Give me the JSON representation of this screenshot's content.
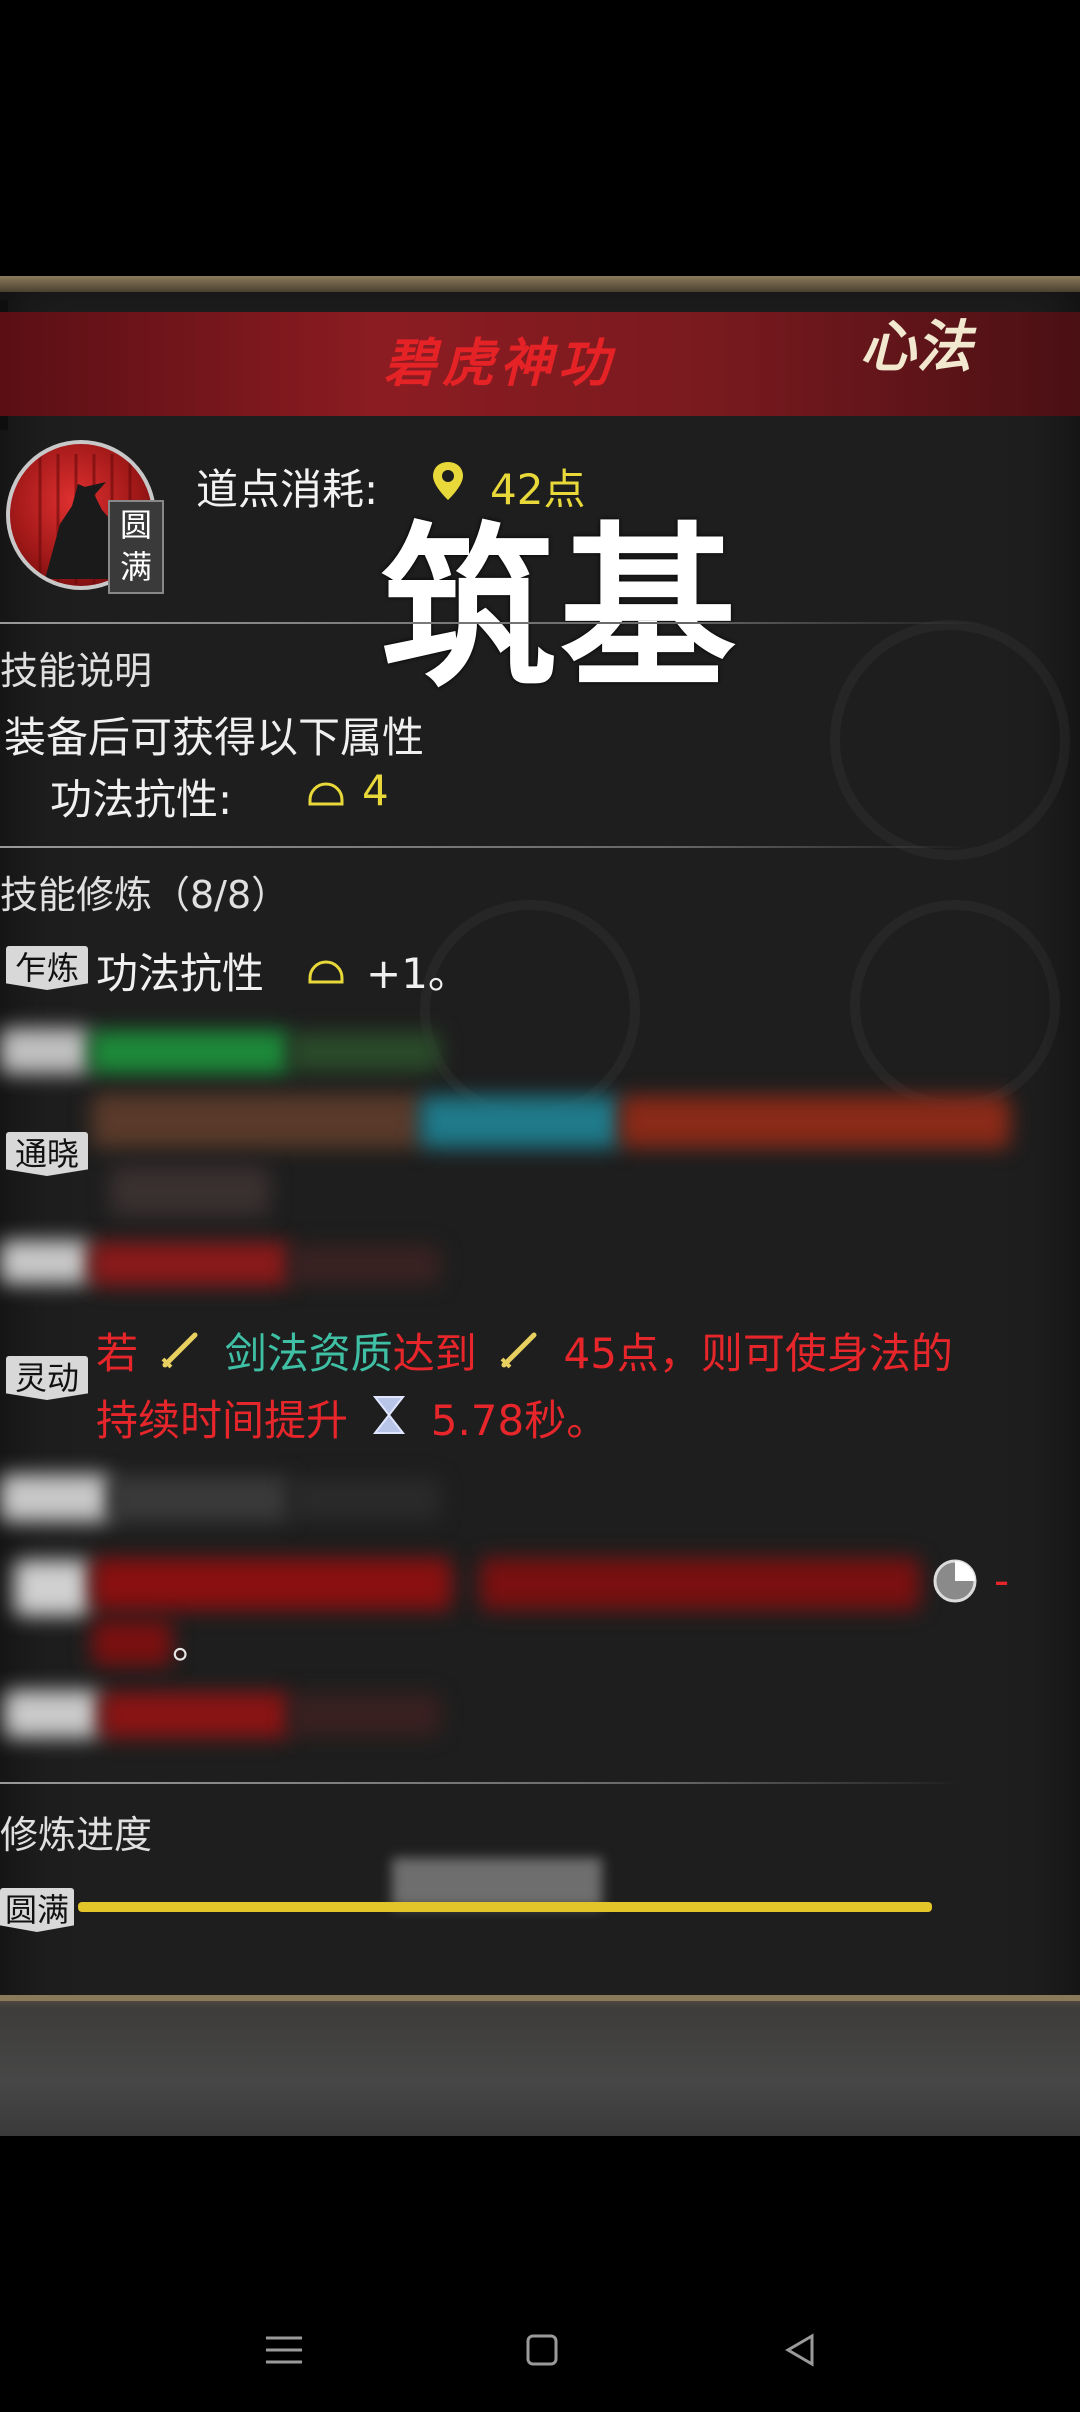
{
  "skill": {
    "title": "碧虎神功",
    "category": "心法",
    "mastery_badge": "圆满",
    "cost_label": "道点消耗:",
    "cost_value": "42点",
    "pin_icon": "pin-icon"
  },
  "overlay": {
    "stage_text": "筑基"
  },
  "description": {
    "title": "技能说明",
    "line1": "装备后可获得以下属性",
    "attr_label": "功法抗性:",
    "attr_value": "4"
  },
  "training": {
    "title": "技能修炼（8/8）",
    "items": [
      {
        "tag": "乍炼",
        "text": "功法抗性",
        "value": "+1。"
      },
      {
        "tag": "通晓"
      },
      {
        "tag": "灵动",
        "p1": "若",
        "p2": "剑法资质",
        "p3": "达到",
        "p4": "45点，则可使身法的",
        "p5": "持续时间提升",
        "p6": "5.78秒。"
      }
    ],
    "trailing_dash": "-",
    "trailing_period": "。"
  },
  "progress": {
    "title": "修炼进度",
    "tag": "圆满",
    "fill_fraction": 1.0
  },
  "colors": {
    "accent_red": "#e6262a",
    "gold": "#e8d83a",
    "teal": "#3fc0a5"
  }
}
